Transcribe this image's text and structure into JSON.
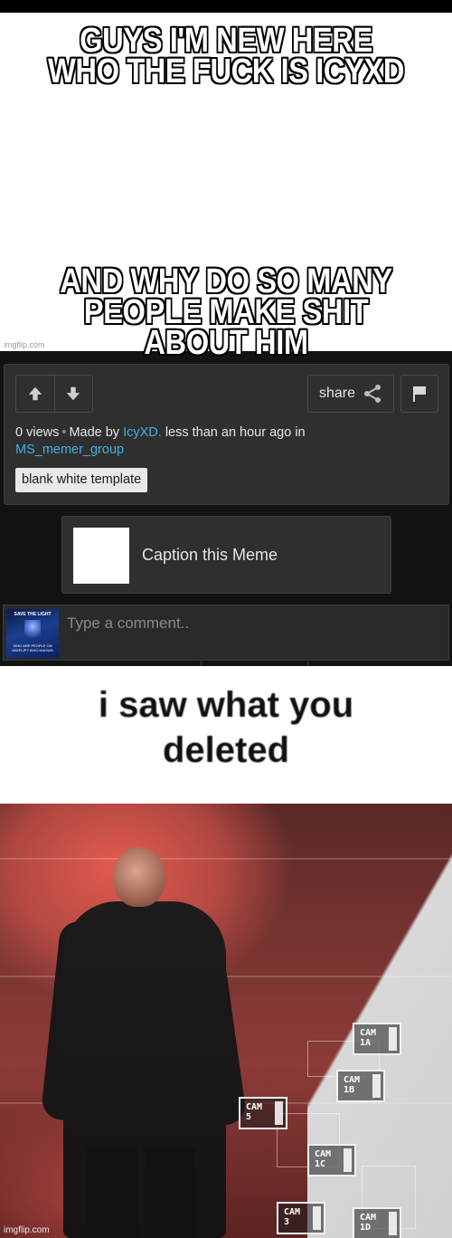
{
  "top_meme": {
    "line1": "GUYS I'M NEW HERE",
    "line2": "WHO THE FUCK IS ICYXD",
    "line3": "AND WHY DO SO MANY",
    "line4": "PEOPLE MAKE SHIT ABOUT HIM",
    "watermark": "imgflip.com"
  },
  "panel": {
    "upvote_icon": "upvote-arrow-icon",
    "downvote_icon": "downvote-arrow-icon",
    "share_label": "share",
    "share_icon": "share-icon",
    "flag_icon": "flag-icon",
    "views": "0 views",
    "made_by_prefix": "Made by",
    "author": "IcyXD.",
    "time_text": "less than an hour ago in",
    "stream": "MS_memer_group",
    "tag": "blank white template"
  },
  "caption": {
    "label": "Caption this Meme"
  },
  "comment": {
    "placeholder": "Type a comment..",
    "avatar_top_text": "SAVE THE LIGHT",
    "avatar_bottom_text": "WHO ARE PEOPLE ON IMGFLIP? WHO KNOWS"
  },
  "bottom_meme": {
    "line1": "i saw what you",
    "line2": "deleted",
    "cams": [
      {
        "id": "cam-1a",
        "text": "CAM\n1A"
      },
      {
        "id": "cam-1b",
        "text": "CAM\n1B"
      },
      {
        "id": "cam-5",
        "text": "CAM\n5"
      },
      {
        "id": "cam-1c",
        "text": "CAM\n1C"
      },
      {
        "id": "cam-3",
        "text": "CAM\n3"
      },
      {
        "id": "cam-1d",
        "text": "CAM\n1D"
      }
    ],
    "watermark": "imgflip.com"
  },
  "colors": {
    "page_bg": "#121212",
    "panel_bg": "#2f2f2f",
    "link": "#3fb3e6",
    "tag_bg": "#e9e9e9"
  }
}
